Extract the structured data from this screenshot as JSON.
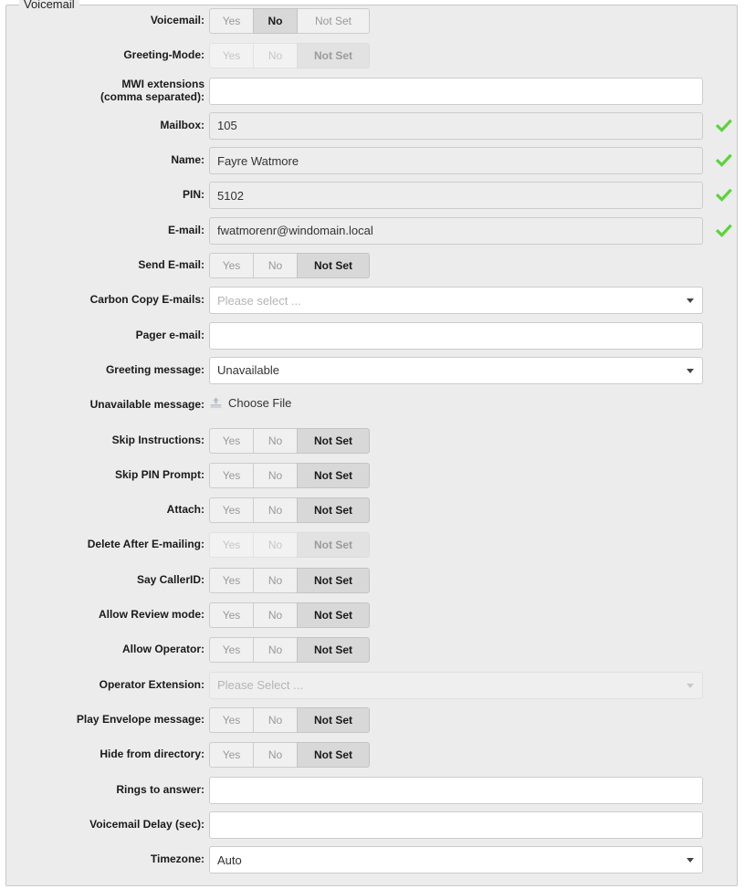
{
  "fieldset": {
    "legend": "Voicemail"
  },
  "colors": {
    "panel_bg": "#ececec",
    "check_green": "#5BD33B",
    "active_toggle_bg": "#d8d8d8",
    "border": "#cccccc"
  },
  "toggle_options": {
    "yes": "Yes",
    "no": "No",
    "not_set": "Not Set"
  },
  "rows": [
    {
      "key": "voicemail",
      "label": "Voicemail:",
      "type": "toggle",
      "selected": "No",
      "disabled": false
    },
    {
      "key": "greeting_mode",
      "label": "Greeting-Mode:",
      "type": "toggle",
      "selected": "Not Set",
      "disabled": true
    },
    {
      "key": "mwi_extensions",
      "label": "MWI extensions\n(comma separated):",
      "type": "text",
      "value": "",
      "placeholder": "",
      "shaded": false,
      "check": false
    },
    {
      "key": "mailbox",
      "label": "Mailbox:",
      "type": "text",
      "value": "105",
      "placeholder": "",
      "shaded": true,
      "check": true
    },
    {
      "key": "name",
      "label": "Name:",
      "type": "text",
      "value": "Fayre Watmore",
      "placeholder": "",
      "shaded": true,
      "check": true
    },
    {
      "key": "pin",
      "label": "PIN:",
      "type": "text",
      "value": "5102",
      "placeholder": "",
      "shaded": true,
      "check": true
    },
    {
      "key": "email",
      "label": "E-mail:",
      "type": "text",
      "value": "fwatmorenr@windomain.local",
      "placeholder": "",
      "shaded": true,
      "check": true
    },
    {
      "key": "send_email",
      "label": "Send E-mail:",
      "type": "toggle",
      "selected": "Not Set",
      "disabled": false
    },
    {
      "key": "carbon_copy_emails",
      "label": "Carbon Copy E-mails:",
      "type": "select",
      "value": "Please select ...",
      "is_placeholder": true,
      "disabled": false
    },
    {
      "key": "pager_email",
      "label": "Pager e-mail:",
      "type": "text",
      "value": "",
      "placeholder": "",
      "shaded": false,
      "check": false
    },
    {
      "key": "greeting_message",
      "label": "Greeting message:",
      "type": "select",
      "value": "Unavailable",
      "is_placeholder": false,
      "disabled": false
    },
    {
      "key": "unavailable_message",
      "label": "Unavailable message:",
      "type": "file",
      "button_label": "Choose File",
      "icon": "upload-icon"
    },
    {
      "key": "skip_instructions",
      "label": "Skip Instructions:",
      "type": "toggle",
      "selected": "Not Set",
      "disabled": false
    },
    {
      "key": "skip_pin_prompt",
      "label": "Skip PIN Prompt:",
      "type": "toggle",
      "selected": "Not Set",
      "disabled": false
    },
    {
      "key": "attach",
      "label": "Attach:",
      "type": "toggle",
      "selected": "Not Set",
      "disabled": false
    },
    {
      "key": "delete_after_emailing",
      "label": "Delete After E-mailing:",
      "type": "toggle",
      "selected": "Not Set",
      "disabled": true
    },
    {
      "key": "say_callerid",
      "label": "Say CallerID:",
      "type": "toggle",
      "selected": "Not Set",
      "disabled": false
    },
    {
      "key": "allow_review_mode",
      "label": "Allow Review mode:",
      "type": "toggle",
      "selected": "Not Set",
      "disabled": false
    },
    {
      "key": "allow_operator",
      "label": "Allow Operator:",
      "type": "toggle",
      "selected": "Not Set",
      "disabled": false
    },
    {
      "key": "operator_extension",
      "label": "Operator Extension:",
      "type": "select",
      "value": "Please Select ...",
      "is_placeholder": true,
      "disabled": true
    },
    {
      "key": "play_envelope_message",
      "label": "Play Envelope message:",
      "type": "toggle",
      "selected": "Not Set",
      "disabled": false
    },
    {
      "key": "hide_from_directory",
      "label": "Hide from directory:",
      "type": "toggle",
      "selected": "Not Set",
      "disabled": false
    },
    {
      "key": "rings_to_answer",
      "label": "Rings to answer:",
      "type": "text",
      "value": "",
      "placeholder": "",
      "shaded": false,
      "check": false
    },
    {
      "key": "voicemail_delay",
      "label": "Voicemail Delay (sec):",
      "type": "text",
      "value": "",
      "placeholder": "",
      "shaded": false,
      "check": false
    },
    {
      "key": "timezone",
      "label": "Timezone:",
      "type": "select",
      "value": "Auto",
      "is_placeholder": false,
      "disabled": false
    }
  ]
}
